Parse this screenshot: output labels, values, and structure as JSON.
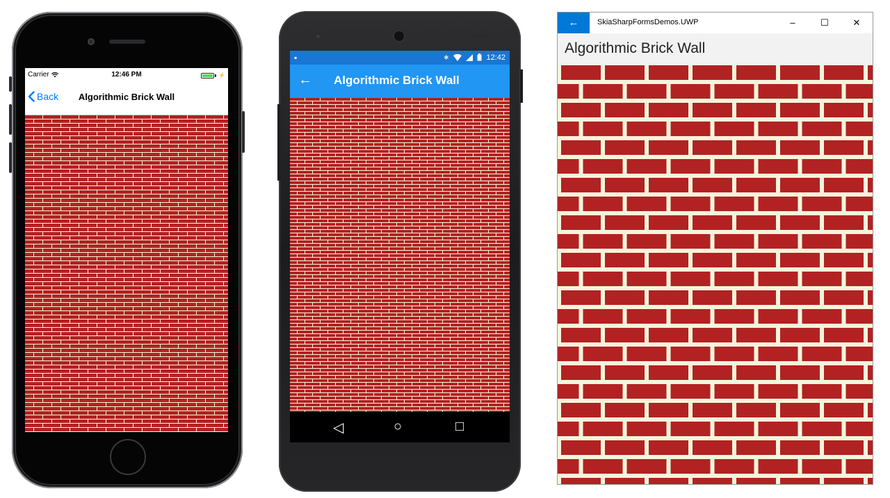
{
  "colors": {
    "brick": "#b22222",
    "mortar": "#f5f5dc",
    "ios_accent": "#007aff",
    "android_statusbar": "#1976d2",
    "android_toolbar": "#2196f3",
    "uwp_accent": "#0078d7"
  },
  "ios": {
    "carrier": "Carrier",
    "time": "12:46 PM",
    "back_label": "Back",
    "title": "Algorithmic Brick Wall",
    "icons": [
      "wifi-icon",
      "battery-icon",
      "chevron-left-icon"
    ]
  },
  "android": {
    "time": "12:42",
    "title": "Algorithmic Brick Wall",
    "back_icon": "←",
    "nav_back": "◁",
    "nav_home": "○",
    "nav_recent": "□",
    "icons": [
      "bluetooth-icon",
      "wifi-icon",
      "signal-icon",
      "battery-icon",
      "android-notification-icon"
    ]
  },
  "uwp": {
    "app_title": "SkiaSharpFormsDemos.UWP",
    "back_icon": "←",
    "minimize_icon": "–",
    "maximize_icon": "☐",
    "close_icon": "✕",
    "page_title": "Algorithmic Brick Wall"
  }
}
